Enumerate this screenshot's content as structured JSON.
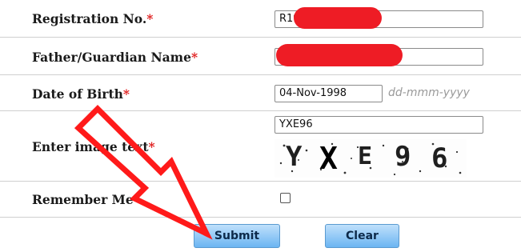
{
  "form": {
    "registration": {
      "label": "Registration No.",
      "required_mark": "*",
      "value": "R19"
    },
    "father": {
      "label": "Father/Guardian Name",
      "required_mark": "*",
      "value": ""
    },
    "dob": {
      "label": "Date of Birth",
      "required_mark": "*",
      "value": "04-Nov-1998",
      "hint": "dd-mmm-yyyy"
    },
    "captcha": {
      "label": "Enter image text",
      "required_mark": "*",
      "value": "YXE96",
      "image_text": [
        "Y",
        "X",
        "E",
        "9",
        "6"
      ]
    },
    "remember": {
      "label": "Remember Me",
      "checked": false
    }
  },
  "buttons": {
    "submit": "Submit",
    "clear": "Clear"
  },
  "colors": {
    "required": "#e02020",
    "redaction": "#ee1c25",
    "button": "#6bb5f2"
  },
  "annotation": {
    "type": "red-arrow-outline",
    "points_to": "submit-button"
  }
}
